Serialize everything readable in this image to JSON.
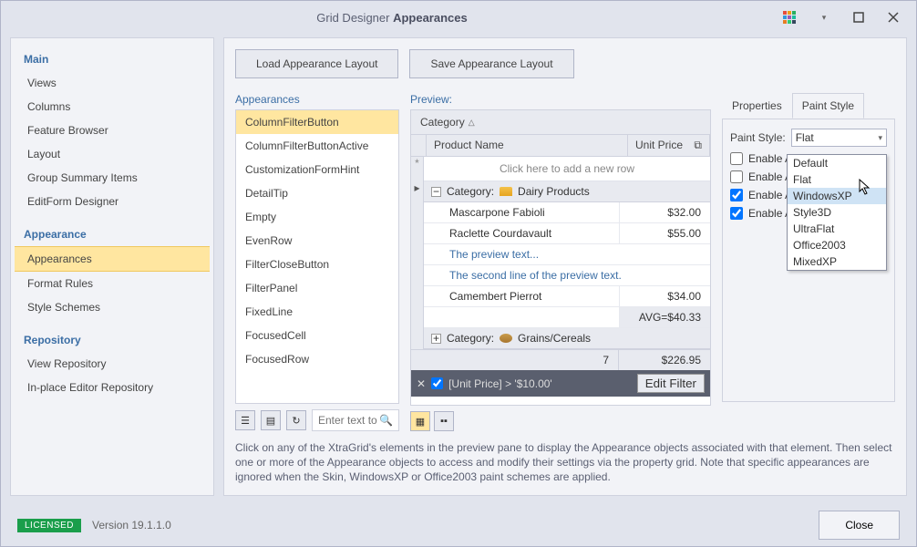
{
  "title": {
    "prefix": "Grid Designer ",
    "bold": "Appearances"
  },
  "sidebar": {
    "sections": [
      {
        "heading": "Main",
        "items": [
          "Views",
          "Columns",
          "Feature Browser",
          "Layout",
          "Group Summary Items",
          "EditForm Designer"
        ]
      },
      {
        "heading": "Appearance",
        "items": [
          "Appearances",
          "Format Rules",
          "Style Schemes"
        ],
        "selected": 0
      },
      {
        "heading": "Repository",
        "items": [
          "View Repository",
          "In-place Editor Repository"
        ]
      }
    ]
  },
  "buttons": {
    "load": "Load Appearance Layout",
    "save": "Save Appearance Layout"
  },
  "appearances": {
    "label": "Appearances",
    "items": [
      "ColumnFilterButton",
      "ColumnFilterButtonActive",
      "CustomizationFormHint",
      "DetailTip",
      "Empty",
      "EvenRow",
      "FilterCloseButton",
      "FilterPanel",
      "FixedLine",
      "FocusedCell",
      "FocusedRow"
    ],
    "selected": 0,
    "search_placeholder": "Enter text to search..."
  },
  "preview": {
    "label": "Preview:",
    "group_by": "Category",
    "columns": [
      "Product Name",
      "Unit Price"
    ],
    "newrow": "Click here to add a new row",
    "group1": {
      "title": "Category:",
      "name": "Dairy Products"
    },
    "rows": [
      {
        "name": "Mascarpone Fabioli",
        "price": "$32.00"
      },
      {
        "name": "Raclette Courdavault",
        "price": "$55.00"
      }
    ],
    "note1": "The preview text...",
    "note2": "The second line of the preview text.",
    "row3": {
      "name": "Camembert Pierrot",
      "price": "$34.00"
    },
    "avg": "AVG=$40.33",
    "group2": {
      "title": "Category:",
      "name": "Grains/Cereals"
    },
    "summary": {
      "count": "7",
      "total": "$226.95"
    },
    "filter": "[Unit Price] > '$10.00'",
    "editfilter": "Edit Filter"
  },
  "props": {
    "tabs": [
      "Properties",
      "Paint Style"
    ],
    "active_tab": 1,
    "ps_label": "Paint Style:",
    "ps_value": "Flat",
    "options": [
      "Default",
      "Flat",
      "WindowsXP",
      "Style3D",
      "UltraFlat",
      "Office2003",
      "MixedXP"
    ],
    "highlighted": 2,
    "checks": [
      {
        "label": "Enable App",
        "checked": false
      },
      {
        "label": "Enable App",
        "checked": false
      },
      {
        "label": "Enable App",
        "checked": true
      },
      {
        "label": "Enable App",
        "checked": true
      }
    ]
  },
  "hint": "Click on any of the XtraGrid's elements in the preview pane to display the Appearance objects associated with that element. Then select one or more of the Appearance objects to access and modify their settings via the property grid. Note that specific appearances are ignored when the Skin, WindowsXP or Office2003 paint schemes are applied.",
  "footer": {
    "badge": "LICENSED",
    "version": "Version 19.1.1.0",
    "close": "Close"
  }
}
